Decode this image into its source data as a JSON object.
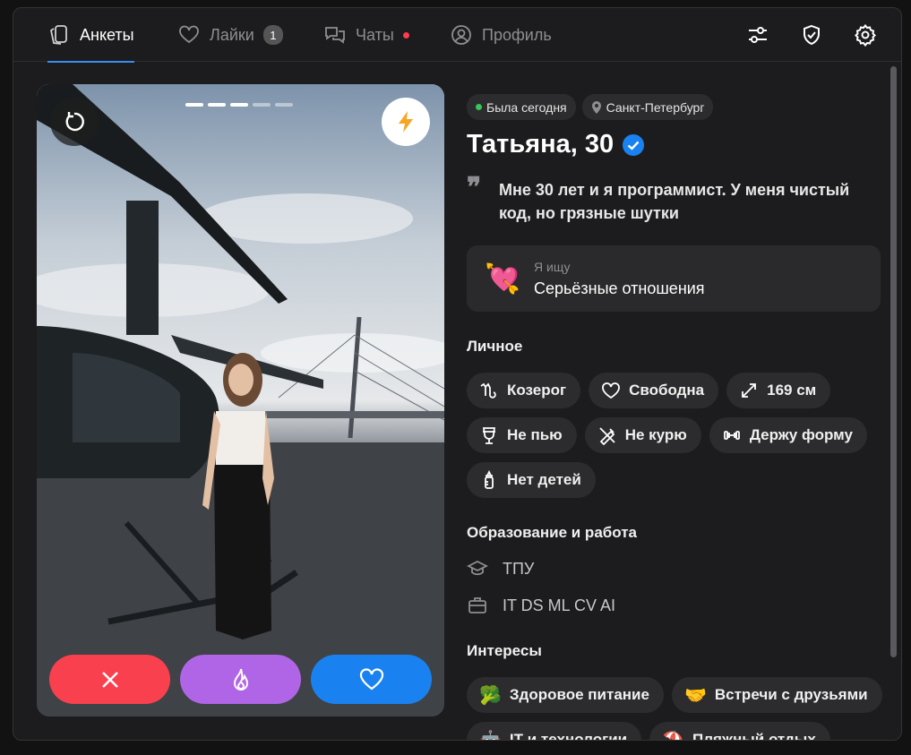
{
  "nav": {
    "tabs": [
      {
        "label": "Анкеты",
        "icon": "cards-icon"
      },
      {
        "label": "Лайки",
        "icon": "heart-icon",
        "badge": "1"
      },
      {
        "label": "Чаты",
        "icon": "chats-icon"
      },
      {
        "label": "Профиль",
        "icon": "profile-icon"
      }
    ],
    "active_tab": "Анкеты",
    "right_icons": [
      "filters-icon",
      "shield-icon",
      "settings-icon"
    ]
  },
  "photo": {
    "count": 5,
    "current": 3,
    "icons": [
      "undo-icon",
      "boost-lightning-icon"
    ]
  },
  "actions": [
    {
      "name": "dislike",
      "color": "#f9404f",
      "icon": "close-icon"
    },
    {
      "name": "superlike",
      "color": "#b065e6",
      "icon": "flame-icon"
    },
    {
      "name": "like",
      "color": "#1a82f0",
      "icon": "heart-icon"
    }
  ],
  "profile": {
    "status": "Была сегодня",
    "city": "Санкт-Петербург",
    "name_age": "Татьяна, 30",
    "bio": "Мне 30 лет и я программист. У меня чистый код, но грязные шутки",
    "seeking_label": "Я ищу",
    "seeking_value": "Серьёзные отношения",
    "seeking_emoji": "💘"
  },
  "sections": {
    "personal": "Личное",
    "education": "Образование и работа",
    "interests": "Интересы"
  },
  "personal": [
    "Козерог",
    "Свободна",
    "169 см",
    "Не пью",
    "Не курю",
    "Держу форму",
    "Нет детей"
  ],
  "education": {
    "school": "ТПУ",
    "job": "IT DS ML CV AI"
  },
  "interests": [
    {
      "emoji": "🥦",
      "label": "Здоровое питание"
    },
    {
      "emoji": "🤝",
      "label": "Встречи с друзьями"
    },
    {
      "emoji": "🤖",
      "label": "IT и технологии"
    },
    {
      "emoji": "⛱️",
      "label": "Пляжный отдых"
    }
  ]
}
